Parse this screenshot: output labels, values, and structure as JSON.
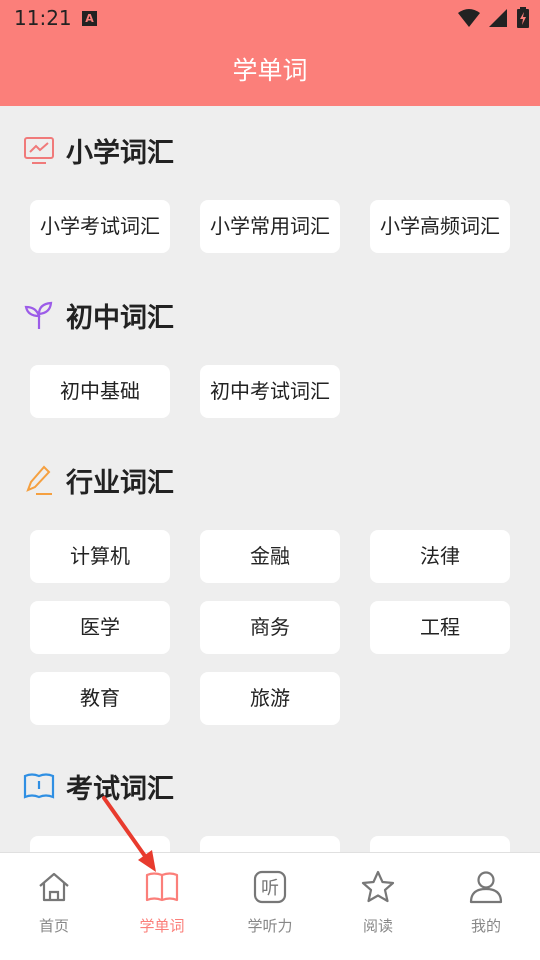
{
  "status": {
    "time": "11:21",
    "notif": "A"
  },
  "header": {
    "title": "学单词"
  },
  "sections": [
    {
      "title": "小学词汇",
      "items": [
        "小学考试词汇",
        "小学常用词汇",
        "小学高频词汇"
      ]
    },
    {
      "title": "初中词汇",
      "items": [
        "初中基础",
        "初中考试词汇"
      ]
    },
    {
      "title": "行业词汇",
      "items": [
        "计算机",
        "金融",
        "法律",
        "医学",
        "商务",
        "工程",
        "教育",
        "旅游"
      ]
    },
    {
      "title": "考试词汇",
      "items": []
    }
  ],
  "tabs": [
    {
      "label": "首页",
      "icon": "home-icon",
      "active": false
    },
    {
      "label": "学单词",
      "icon": "book-icon",
      "active": true
    },
    {
      "label": "学听力",
      "icon": "listen-icon",
      "active": false,
      "glyph": "听"
    },
    {
      "label": "阅读",
      "icon": "star-icon",
      "active": false
    },
    {
      "label": "我的",
      "icon": "person-icon",
      "active": false
    }
  ],
  "colors": {
    "accent": "#fb7f7a",
    "arrow": "#e83b2e"
  }
}
